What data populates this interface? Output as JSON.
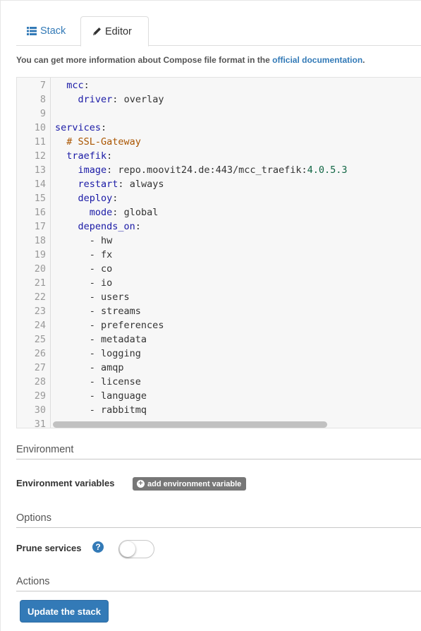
{
  "tabs": [
    {
      "label": "Stack",
      "icon": "list-icon",
      "active": false
    },
    {
      "label": "Editor",
      "icon": "pencil-icon",
      "active": true
    }
  ],
  "info": {
    "text": "You can get more information about Compose file format in the ",
    "link_text": "official documentation",
    "suffix": "."
  },
  "editor": {
    "lines": [
      {
        "num": "7",
        "indent": "  ",
        "key": "mcc",
        "sep": ":",
        "value": "",
        "tail": ""
      },
      {
        "num": "8",
        "indent": "    ",
        "key": "driver",
        "sep": ": ",
        "value": "overlay",
        "tail": ""
      },
      {
        "num": "9",
        "indent": "",
        "key": "",
        "sep": "",
        "value": "",
        "tail": ""
      },
      {
        "num": "10",
        "indent": "",
        "key": "services",
        "sep": ":",
        "value": "",
        "tail": ""
      },
      {
        "num": "11",
        "indent": "  ",
        "comment": "# SSL-Gateway"
      },
      {
        "num": "12",
        "indent": "  ",
        "key": "traefik",
        "sep": ":",
        "value": "",
        "tail": ""
      },
      {
        "num": "13",
        "indent": "    ",
        "key": "image",
        "sep": ": ",
        "value": "repo.moovit24.de:443/mcc_traefik:",
        "tail": "4.0.5.3"
      },
      {
        "num": "14",
        "indent": "    ",
        "key": "restart",
        "sep": ": ",
        "value": "always",
        "tail": ""
      },
      {
        "num": "15",
        "indent": "    ",
        "key": "deploy",
        "sep": ":",
        "value": "",
        "tail": ""
      },
      {
        "num": "16",
        "indent": "      ",
        "key": "mode",
        "sep": ": ",
        "value": "global",
        "tail": ""
      },
      {
        "num": "17",
        "indent": "    ",
        "key": "depends_on",
        "sep": ":",
        "value": "",
        "tail": ""
      },
      {
        "num": "18",
        "indent": "      ",
        "key": "",
        "sep": "",
        "value": "- hw",
        "tail": ""
      },
      {
        "num": "19",
        "indent": "      ",
        "key": "",
        "sep": "",
        "value": "- fx",
        "tail": ""
      },
      {
        "num": "20",
        "indent": "      ",
        "key": "",
        "sep": "",
        "value": "- co",
        "tail": ""
      },
      {
        "num": "21",
        "indent": "      ",
        "key": "",
        "sep": "",
        "value": "- io",
        "tail": ""
      },
      {
        "num": "22",
        "indent": "      ",
        "key": "",
        "sep": "",
        "value": "- users",
        "tail": ""
      },
      {
        "num": "23",
        "indent": "      ",
        "key": "",
        "sep": "",
        "value": "- streams",
        "tail": ""
      },
      {
        "num": "24",
        "indent": "      ",
        "key": "",
        "sep": "",
        "value": "- preferences",
        "tail": ""
      },
      {
        "num": "25",
        "indent": "      ",
        "key": "",
        "sep": "",
        "value": "- metadata",
        "tail": ""
      },
      {
        "num": "26",
        "indent": "      ",
        "key": "",
        "sep": "",
        "value": "- logging",
        "tail": ""
      },
      {
        "num": "27",
        "indent": "      ",
        "key": "",
        "sep": "",
        "value": "- amqp",
        "tail": ""
      },
      {
        "num": "28",
        "indent": "      ",
        "key": "",
        "sep": "",
        "value": "- license",
        "tail": ""
      },
      {
        "num": "29",
        "indent": "      ",
        "key": "",
        "sep": "",
        "value": "- language",
        "tail": ""
      },
      {
        "num": "30",
        "indent": "      ",
        "key": "",
        "sep": "",
        "value": "- rabbitmq",
        "tail": ""
      },
      {
        "num": "31",
        "indent": "",
        "key": "",
        "sep": "",
        "value": "",
        "tail": ""
      }
    ]
  },
  "environment": {
    "title": "Environment",
    "vars_label": "Environment variables",
    "add_button": "add environment variable"
  },
  "options": {
    "title": "Options",
    "prune_label": "Prune services",
    "help_glyph": "?",
    "prune_enabled": false
  },
  "actions": {
    "title": "Actions",
    "update_button": "Update the stack"
  },
  "colors": {
    "accent": "#337ab7",
    "yaml_key": "#1a1aa6",
    "yaml_comment": "#aa5500",
    "yaml_number": "#116644"
  }
}
